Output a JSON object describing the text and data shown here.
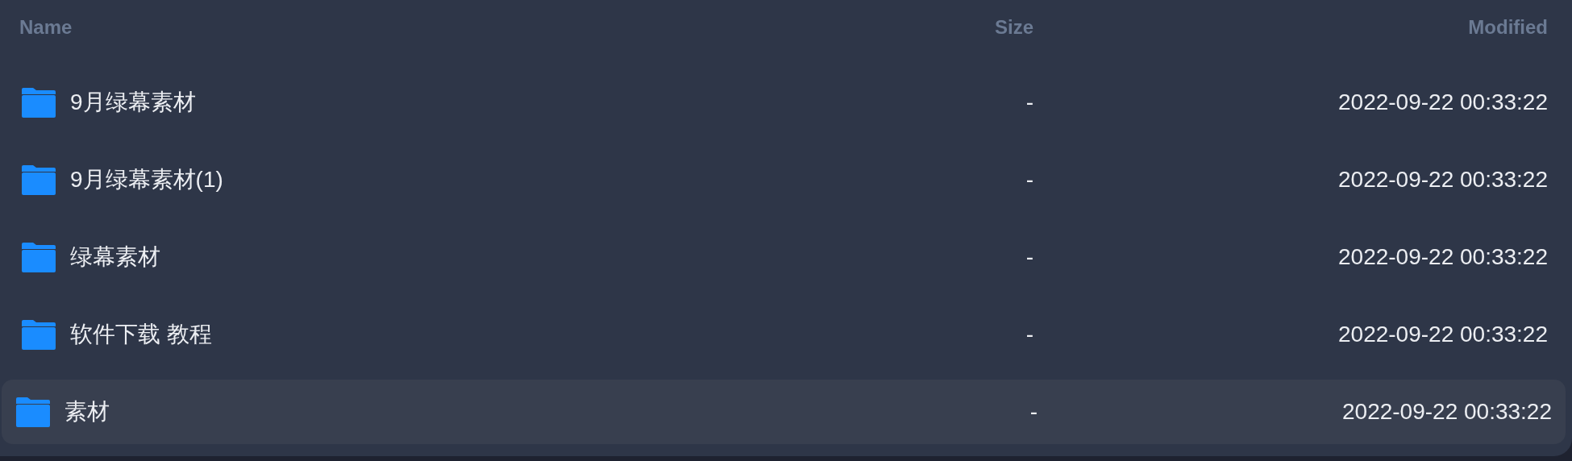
{
  "columns": [
    {
      "label": "Name"
    },
    {
      "label": "Size"
    },
    {
      "label": "Modified"
    }
  ],
  "rows": [
    {
      "name": "9月绿幕素材",
      "size": "-",
      "modified": "2022-09-22 00:33:22",
      "selected": false
    },
    {
      "name": "9月绿幕素材(1)",
      "size": "-",
      "modified": "2022-09-22 00:33:22",
      "selected": false
    },
    {
      "name": "绿幕素材",
      "size": "-",
      "modified": "2022-09-22 00:33:22",
      "selected": false
    },
    {
      "name": "软件下载 教程",
      "size": "-",
      "modified": "2022-09-22 00:33:22",
      "selected": false
    },
    {
      "name": "素材",
      "size": "-",
      "modified": "2022-09-22 00:33:22",
      "selected": true
    }
  ]
}
